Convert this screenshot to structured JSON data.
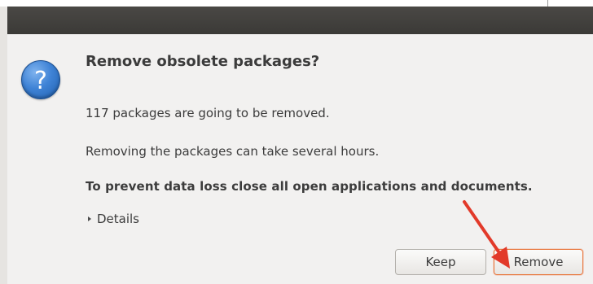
{
  "dialog": {
    "heading": "Remove obsolete packages?",
    "line1": "117 packages are going to be removed.",
    "line2": "Removing the packages can take several hours.",
    "warning": "To prevent data loss close all open applications and documents.",
    "details_label": "Details",
    "icon": "question-icon"
  },
  "buttons": {
    "keep": "Keep",
    "remove": "Remove"
  },
  "annotation": {
    "arrow_color": "#e23a2a"
  }
}
